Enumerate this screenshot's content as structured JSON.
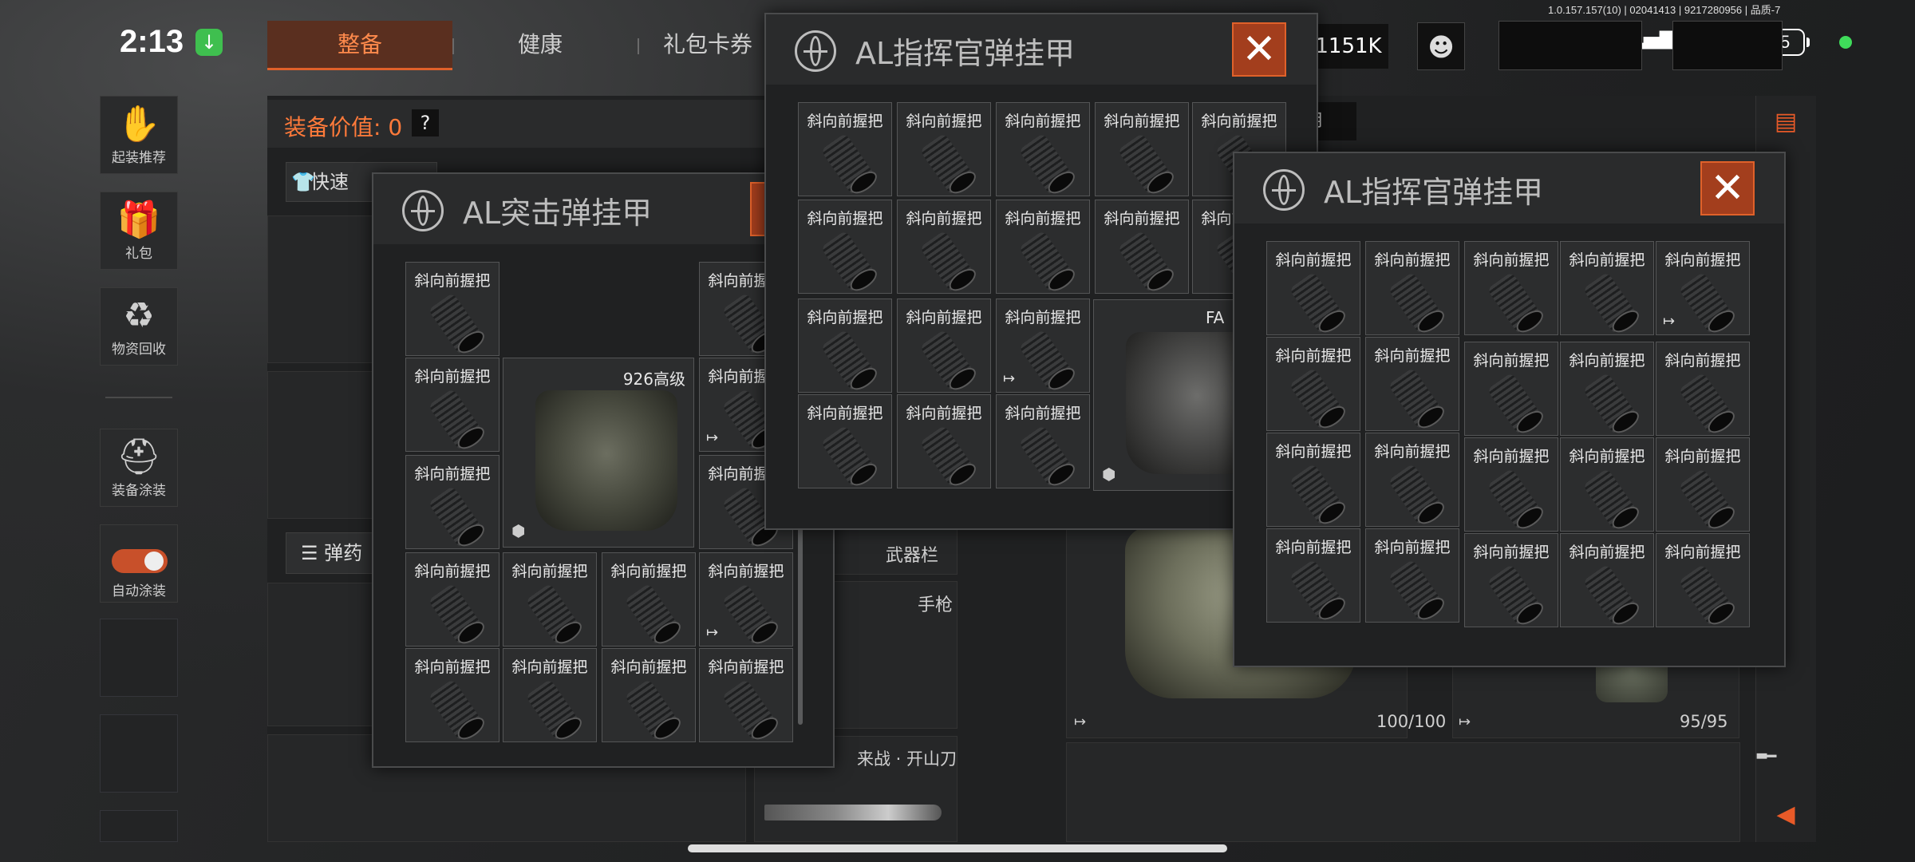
{
  "status_bar": {
    "time": "2:13",
    "version": "1.0.157.157(10) | 02041413 | 9217280956 | 品质-7",
    "battery": "55"
  },
  "nav": {
    "tabs": [
      "整备",
      "健康",
      "礼包卡券"
    ],
    "active": "整备"
  },
  "header": {
    "currency": "1151K"
  },
  "sidebar": {
    "items": [
      {
        "label": "起装推荐",
        "icon": "rifle-hand-icon"
      },
      {
        "label": "礼包",
        "icon": "gift-icon"
      },
      {
        "label": "物资回收",
        "icon": "recycle-icon"
      },
      {
        "label": "装备涂装",
        "icon": "helmet-icon"
      },
      {
        "label": "自动涂装",
        "icon": "toggle-icon"
      }
    ],
    "auto_paint_on": true
  },
  "main": {
    "equip_value_label": "装备价值: 0",
    "help": "?",
    "quick_button": "快速",
    "ammo_button": "弹药",
    "weapon_slot_label": "武器栏",
    "pistol_label": "手枪",
    "melee_label": "来战 · 开山刀",
    "vest_durability": "100/100",
    "rig_durability": "95/95",
    "filter_label": "用"
  },
  "windows": [
    {
      "title": "AL突击弹挂甲",
      "bag_label": "926高级",
      "item_label": "斜向前握把"
    },
    {
      "title": "AL指挥官弹挂甲",
      "bag_label": "FA",
      "item_label": "斜向前握把"
    },
    {
      "title": "AL指挥官弹挂甲",
      "item_label": "斜向前握把"
    }
  ],
  "colors": {
    "accent": "#e0612a",
    "close_bg": "#a33e1d",
    "panel": "#202122"
  }
}
